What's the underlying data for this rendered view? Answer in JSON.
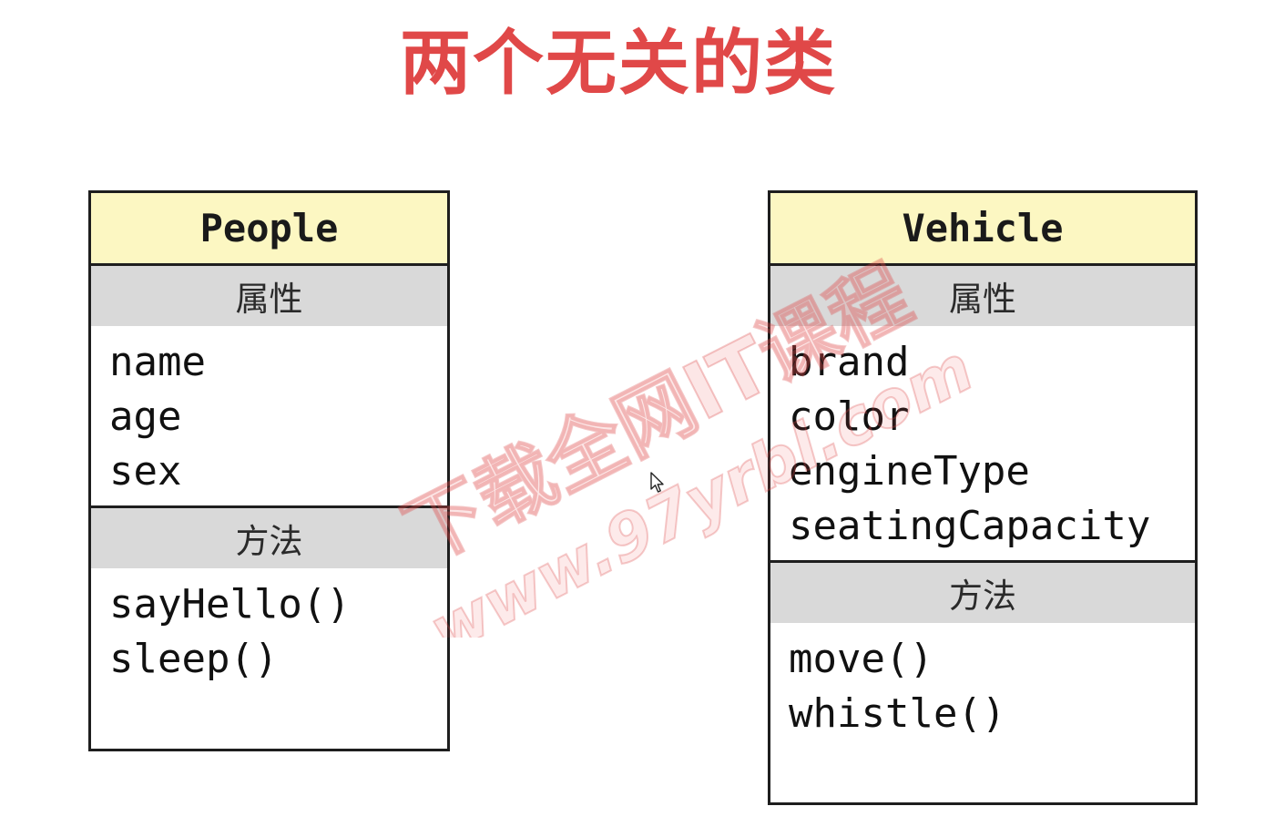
{
  "title": "两个无关的类",
  "classes": {
    "people": {
      "name": "People",
      "attributes_header": "属性",
      "attributes": [
        "name",
        "age",
        "sex"
      ],
      "methods_header": "方法",
      "methods": [
        "sayHello()",
        "sleep()"
      ]
    },
    "vehicle": {
      "name": "Vehicle",
      "attributes_header": "属性",
      "attributes": [
        "brand",
        "color",
        "engineType",
        "seatingCapacity"
      ],
      "methods_header": "方法",
      "methods": [
        "move()",
        "whistle()"
      ]
    }
  },
  "watermark": {
    "line1": "下载全网IT课程",
    "line2": "www.97yrbl.com"
  },
  "colors": {
    "title": "#e04848",
    "class_header_bg": "#fcf7c2",
    "section_bar_bg": "#d9d9d9",
    "border": "#1e1e1e"
  },
  "icons": [
    "mouse-cursor-icon"
  ]
}
